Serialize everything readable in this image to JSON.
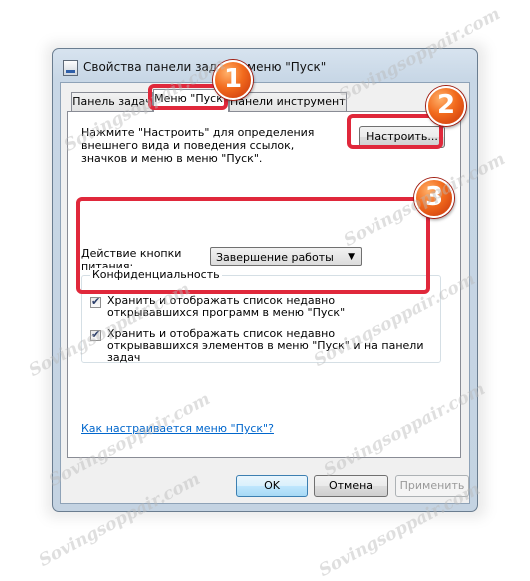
{
  "window": {
    "title": "Свойства панели задач и меню \"Пуск\""
  },
  "tabs": [
    {
      "label": "Панель задач"
    },
    {
      "label": "Меню \"Пуск\""
    },
    {
      "label": "Панели инструментов"
    }
  ],
  "start_menu": {
    "description": "Нажмите \"Настроить\" для определения внешнего вида и поведения ссылок, значков и меню в меню \"Пуск\".",
    "customize_label": "Настроить...",
    "power_label": "Действие кнопки питания:",
    "power_value": "Завершение работы"
  },
  "privacy": {
    "title": "Конфиденциальность",
    "items": [
      {
        "label": "Хранить и отображать список недавно открывавшихся программ в меню \"Пуск\"",
        "checked": true
      },
      {
        "label": "Хранить и отображать список недавно открывавшихся элементов в меню \"Пуск\" и на панели задач",
        "checked": true
      }
    ]
  },
  "help_link": "Как настраивается меню \"Пуск\"?",
  "buttons": {
    "ok": "OK",
    "cancel": "Отмена",
    "apply": "Применить"
  },
  "annotations": {
    "badge1": "1",
    "badge2": "2",
    "badge3": "3"
  },
  "watermark": "Sovingsoppair.com",
  "icons": {
    "app": "taskbar-properties-icon",
    "dropdown": "chevron-down-icon",
    "check": "check-icon"
  },
  "colors": {
    "highlight": "#e0283b",
    "badge": "#f26b1d",
    "link": "#0066cc"
  }
}
